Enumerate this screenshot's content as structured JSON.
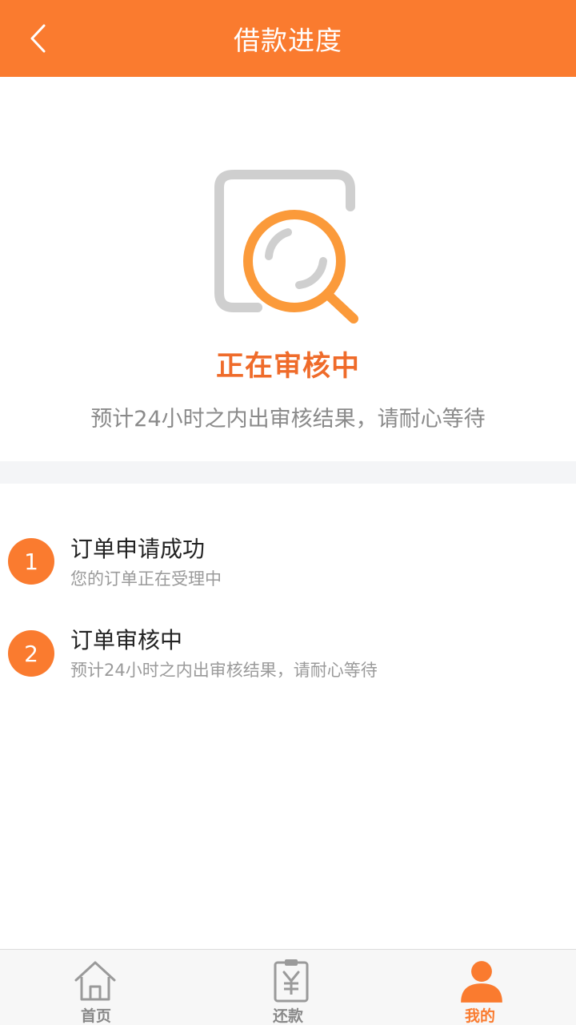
{
  "header": {
    "title": "借款进度",
    "back_icon": "chevron-left-icon"
  },
  "status": {
    "icon": "document-search-icon",
    "title": "正在审核中",
    "description": "预计24小时之内出审核结果，请耐心等待"
  },
  "steps": [
    {
      "number": "1",
      "title": "订单申请成功",
      "description": "您的订单正在受理中"
    },
    {
      "number": "2",
      "title": "订单审核中",
      "description": "预计24小时之内出审核结果，请耐心等待"
    }
  ],
  "tabbar": {
    "items": [
      {
        "label": "首页",
        "icon": "home-icon",
        "active": false
      },
      {
        "label": "还款",
        "icon": "repayment-icon",
        "active": false
      },
      {
        "label": "我的",
        "icon": "user-icon",
        "active": true
      }
    ]
  },
  "colors": {
    "accent": "#fa7b2f",
    "status_title": "#ef6b2a",
    "inactive_icon": "#9a9a9a"
  }
}
